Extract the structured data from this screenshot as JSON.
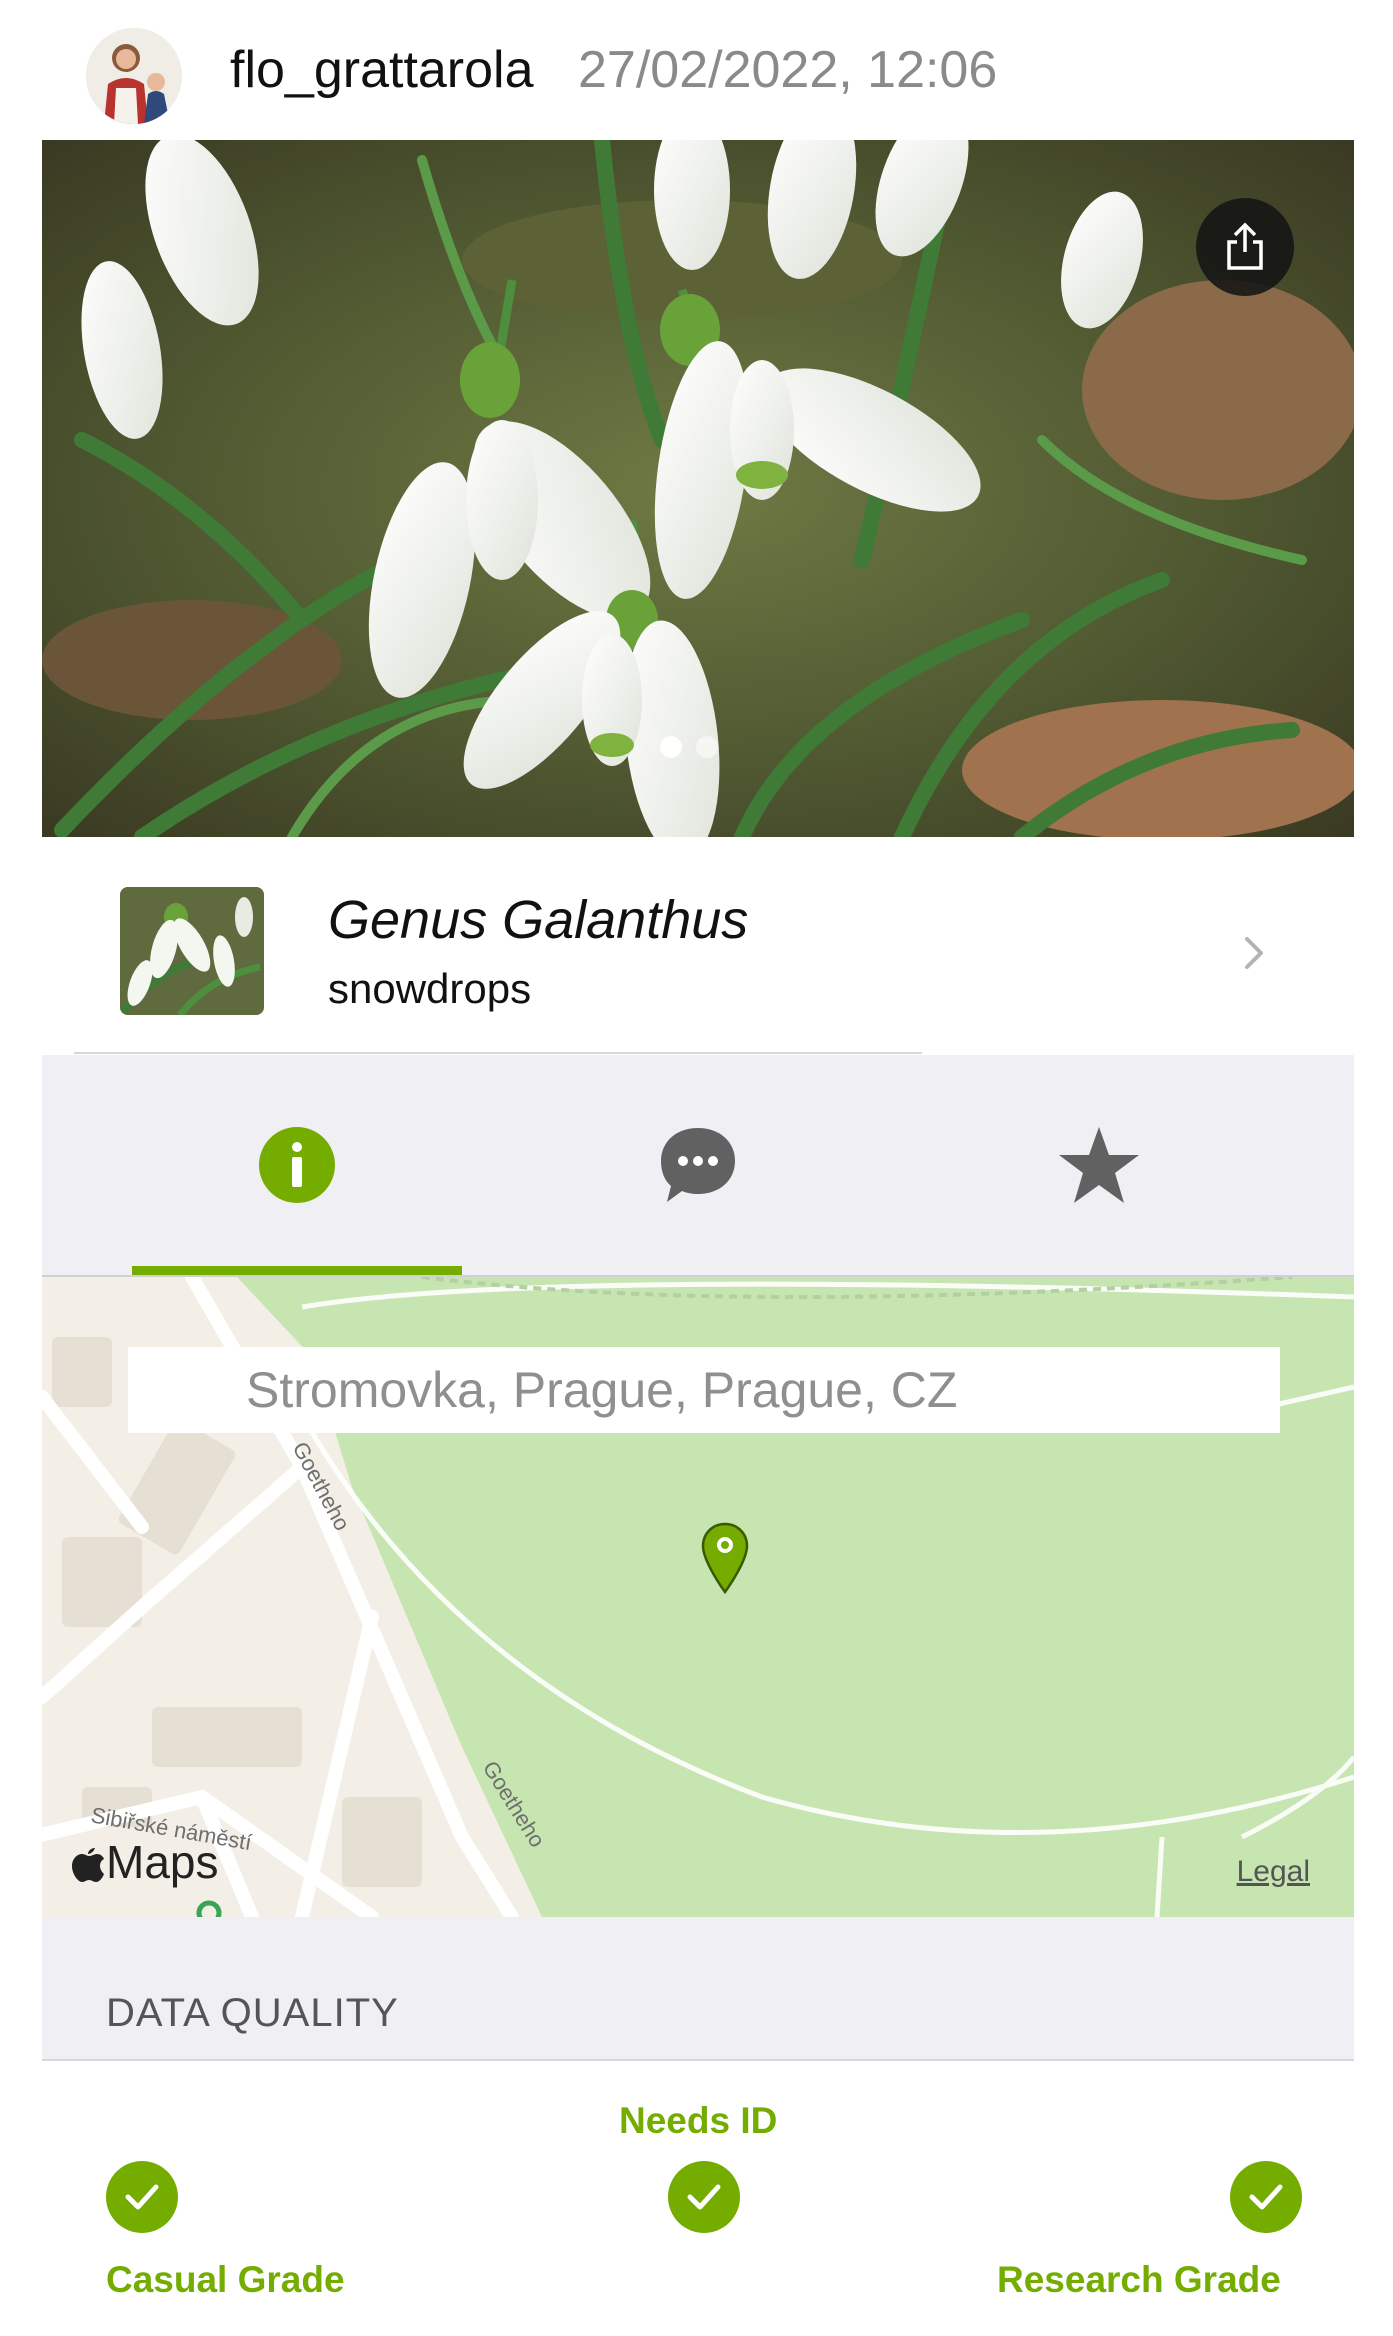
{
  "header": {
    "username": "flo_grattarola",
    "timestamp": "27/02/2022, 12:06"
  },
  "photo": {
    "pages": 2,
    "current_page": 1
  },
  "taxon": {
    "name": "Genus Galanthus",
    "common_name": "snowdrops"
  },
  "tabs": [
    {
      "name": "info",
      "icon": "info-icon",
      "active": true
    },
    {
      "name": "comments",
      "icon": "speech-bubble-icon",
      "active": false
    },
    {
      "name": "favorites",
      "icon": "star-icon",
      "active": false
    }
  ],
  "map": {
    "location": "Stromovka, Prague, Prague, CZ",
    "street_labels": [
      "Goetheho",
      "Sibiřské náměstí",
      "Goetheho"
    ],
    "maps_label": "Maps",
    "legal_label": "Legal"
  },
  "data_quality": {
    "title": "DATA QUALITY",
    "levels": [
      {
        "label": "Casual Grade",
        "checked": true
      },
      {
        "label": "Needs ID",
        "checked": true
      },
      {
        "label": "Research Grade",
        "checked": true
      }
    ]
  },
  "colors": {
    "accent": "#74ac00",
    "map_park": "#c6e5b0",
    "map_land": "#f3efe6",
    "tab_background": "#efeff4"
  }
}
